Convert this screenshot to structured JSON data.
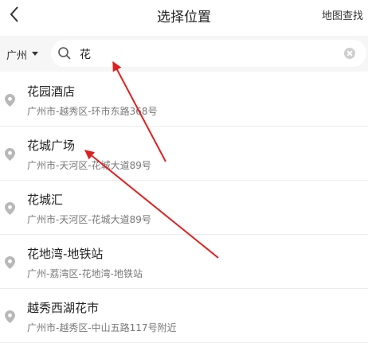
{
  "header": {
    "title": "选择位置",
    "map_search_label": "地图查找"
  },
  "search": {
    "city": "广州",
    "query": "花"
  },
  "results": [
    {
      "name": "花园酒店",
      "address": "广州市-越秀区-环市东路368号"
    },
    {
      "name": "花城广场",
      "address": "广州市-天河区-花城大道89号"
    },
    {
      "name": "花城汇",
      "address": "广州市-天河区-花城大道89号"
    },
    {
      "name": "花地湾-地铁站",
      "address": "广州-荔湾区-花地湾-地铁站"
    },
    {
      "name": "越秀西湖花市",
      "address": "广州市-越秀区-中山五路117号附近"
    }
  ],
  "icons": {
    "back": "chevron-left-icon",
    "caret": "caret-down-icon",
    "search": "search-icon",
    "clear": "clear-icon",
    "pin": "location-pin-icon"
  },
  "colors": {
    "annotation_arrow": "#e02020",
    "pin": "#b8b8b8",
    "search_bar_bg": "#f6f6f6"
  }
}
